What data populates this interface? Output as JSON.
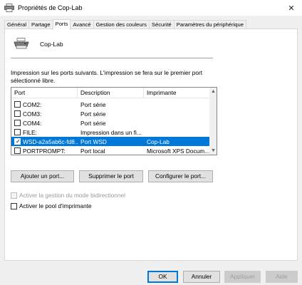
{
  "window": {
    "title": "Propriétés de Cop-Lab",
    "close_glyph": "✕"
  },
  "tabs": [
    {
      "label": "Général"
    },
    {
      "label": "Partage"
    },
    {
      "label": "Ports",
      "active": true
    },
    {
      "label": "Avancé"
    },
    {
      "label": "Gestion des couleurs"
    },
    {
      "label": "Sécurité"
    },
    {
      "label": "Paramètres du périphérique"
    }
  ],
  "printer": {
    "name": "Cop-Lab",
    "icon": "printer-icon"
  },
  "description": "Impression sur les ports suivants. L'impression se fera sur le premier port sélectionné libre.",
  "ports_table": {
    "headers": [
      "Port",
      "Description",
      "Imprimante"
    ],
    "rows": [
      {
        "port": "COM2:",
        "description": "Port série",
        "printer": "",
        "checked": false,
        "selected": false
      },
      {
        "port": "COM3:",
        "description": "Port série",
        "printer": "",
        "checked": false,
        "selected": false
      },
      {
        "port": "COM4:",
        "description": "Port série",
        "printer": "",
        "checked": false,
        "selected": false
      },
      {
        "port": "FILE:",
        "description": "Impression dans un fi...",
        "printer": "",
        "checked": false,
        "selected": false
      },
      {
        "port": "WSD-a2a5ab6c-fd8...",
        "description": "Port WSD",
        "printer": "Cop-Lab",
        "checked": true,
        "selected": true
      },
      {
        "port": "PORTPROMPT:",
        "description": "Port local",
        "printer": "Microsoft XPS Docum...",
        "checked": false,
        "selected": false
      }
    ]
  },
  "port_buttons": {
    "add": "Ajouter un port...",
    "delete": "Supprimer le port",
    "configure": "Configurer le port..."
  },
  "options": {
    "bidirectional": {
      "label": "Activer la gestion du mode bidirectionnel",
      "enabled": false,
      "checked": false
    },
    "pool": {
      "label": "Activer le pool d'imprimante",
      "enabled": true,
      "checked": false
    }
  },
  "footer": {
    "ok": "OK",
    "cancel": "Annuler",
    "apply": "Appliquer",
    "help": "Aide"
  },
  "colors": {
    "selection": "#0078d7",
    "default_button_border": "#0078d7"
  }
}
